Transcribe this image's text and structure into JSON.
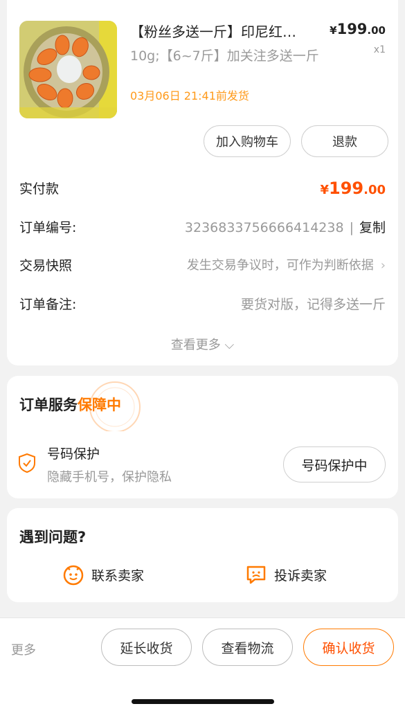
{
  "product": {
    "title": "【粉丝多送一斤】印尼红…",
    "price_symbol": "¥",
    "price_int": "199",
    "price_dec": ".00",
    "quantity": "x1",
    "spec": "10g;【6~7斤】加关注多送一斤",
    "ship_time": "03月06日 21:41前发货",
    "image_icon": "jackfruit-photo"
  },
  "actions": {
    "add_cart": "加入购物车",
    "refund": "退款"
  },
  "order": {
    "paid_label": "实付款",
    "paid_symbol": "¥",
    "paid_int": "199",
    "paid_dec": ".00",
    "number_label": "订单编号:",
    "number_value": "3236833756666414238",
    "separator": "|",
    "copy_label": "复制",
    "snapshot_label": "交易快照",
    "snapshot_value": "发生交易争议时，可作为判断依据",
    "snapshot_chevron": "›",
    "remark_label": "订单备注:",
    "remark_value": "要货对版，记得多送一斤",
    "see_more": "查看更多 ⌵"
  },
  "service": {
    "title_prefix": "订单服务",
    "title_highlight": "保障中",
    "item_name": "号码保护",
    "item_desc": "隐藏手机号，保护隐私",
    "item_button": "号码保护中",
    "item_icon": "shield-check-icon"
  },
  "help": {
    "title": "遇到问题?",
    "contact": "联系卖家",
    "complain": "投诉卖家"
  },
  "bottom": {
    "more": "更多",
    "extend": "延长收货",
    "logistics": "查看物流",
    "confirm": "确认收货"
  },
  "colors": {
    "accent": "#ff5000",
    "highlight": "#ff7a00",
    "ship_time": "#ff9a1a"
  }
}
